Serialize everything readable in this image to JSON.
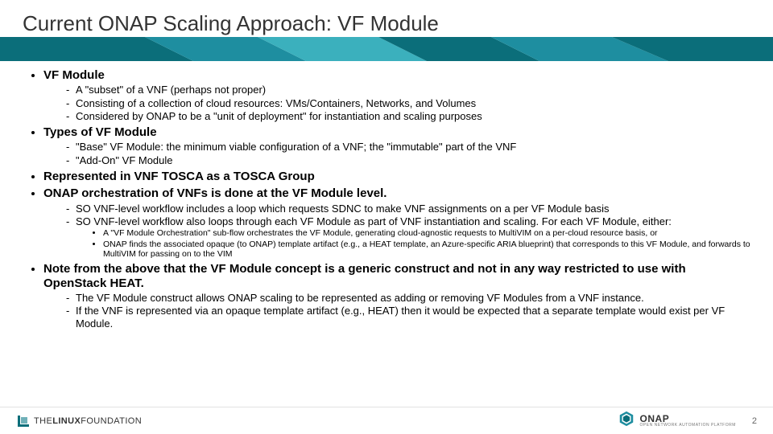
{
  "title": "Current ONAP Scaling Approach: VF Module",
  "bullets": {
    "b1": "VF Module",
    "b1_subs": {
      "s1": "A \"subset\" of a VNF (perhaps not proper)",
      "s2": "Consisting of a collection of cloud resources: VMs/Containers, Networks, and Volumes",
      "s3": "Considered by ONAP to be a \"unit of deployment\" for instantiation and scaling purposes"
    },
    "b2": "Types of VF Module",
    "b2_subs": {
      "s1": "\"Base\" VF Module: the minimum viable configuration of a VNF;  the \"immutable\" part of the VNF",
      "s2": "\"Add-On\" VF Module"
    },
    "b3": "Represented in VNF TOSCA as a TOSCA Group",
    "b4": "ONAP orchestration of VNFs is done at the VF Module level.",
    "b4_subs": {
      "s1": "SO VNF-level workflow includes a loop which requests SDNC to make VNF assignments on a per VF Module basis",
      "s2": "SO VNF-level workflow also loops through each VF Module as part of VNF instantiation and scaling.  For each VF Module, either:",
      "s2_third": {
        "t1": "A \"VF Module Orchestration\" sub-flow orchestrates the VF Module, generating cloud-agnostic requests to MultiVIM on a per-cloud resource basis, or",
        "t2": "ONAP finds the associated opaque (to ONAP) template artifact (e.g., a HEAT template, an Azure-specific ARIA blueprint) that corresponds to this VF Module, and forwards to MultiVIM for passing on to the VIM"
      }
    },
    "b5": "Note from the above that the VF Module concept is a generic construct and not in any way restricted to use with OpenStack HEAT.",
    "b5_subs": {
      "s1": "The VF Module construct allows ONAP scaling to be represented as adding or removing VF Modules from a VNF instance.",
      "s2": "If the VNF is represented via an opaque template artifact (e.g., HEAT) then it would be expected that a separate template would exist per VF Module."
    }
  },
  "footer": {
    "lf_the": "THE",
    "lf_linux": "LINUX",
    "lf_foundation": "FOUNDATION",
    "onap_main": "ONAP",
    "onap_sub": "OPEN NETWORK AUTOMATION PLATFORM",
    "page": "2"
  },
  "colors": {
    "teal1": "#0b6e7a",
    "teal2": "#1e8ea0",
    "teal3": "#3bb0bd"
  }
}
